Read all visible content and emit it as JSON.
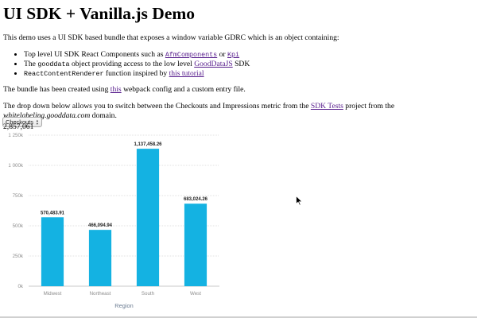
{
  "page": {
    "title": "UI SDK + Vanilla.js Demo",
    "intro": "This demo uses a UI SDK based bundle that exposes a window variable GDRC which is an object containing:",
    "list": {
      "item1": {
        "text": "Top level UI SDK React Components such as ",
        "link1": "AfmComponents",
        "sep": " or ",
        "link2": "Kpi"
      },
      "item2": {
        "prefix": "The ",
        "code": "gooddata",
        "mid": " object providing access to the low level ",
        "link": "GoodDataJS",
        "suffix": " SDK"
      },
      "item3": {
        "code": "ReactContentRenderer",
        "mid": " function inspired by ",
        "link": "this tutorial"
      }
    },
    "bundle": {
      "prefix": "The bundle has been created using ",
      "link": "this",
      "suffix": " webpack config and a custom entry file."
    },
    "dropdown_text": {
      "prefix": "The drop down below allows you to switch between the Checkouts and Impressions metric from the ",
      "link": "SDK Tests",
      "mid": " project from the ",
      "em": "whitelabeling.gooddata.com",
      "suffix": " domain."
    }
  },
  "controls": {
    "metric_select": {
      "selected": "Checkouts"
    },
    "kpi_value": "2,857,061"
  },
  "colors": {
    "bar": "#14b2e2",
    "link": "#551a8b",
    "axis_title": "#6d7d93",
    "tick": "#8d8d8d"
  },
  "icons": {
    "cursor": "mouse-pointer-icon",
    "select_arrows": "up-down-arrows-icon"
  },
  "chart_data": {
    "type": "bar",
    "categories": [
      "Midwest",
      "Northeast",
      "South",
      "West"
    ],
    "values": [
      570483.91,
      466094.94,
      1137458.26,
      683024.26
    ],
    "data_labels": [
      "570,483.91",
      "466,094.94",
      "1,137,458.26",
      "683,024.26"
    ],
    "xlabel": "Region",
    "ylabel": "",
    "ylim": [
      0,
      1250000
    ],
    "yticks": [
      0,
      250000,
      500000,
      750000,
      1000000,
      1250000
    ],
    "ytick_labels": [
      "0k",
      "250k",
      "500k",
      "750k",
      "1 000k",
      "1 250k"
    ],
    "grid": true,
    "legend": "none"
  }
}
